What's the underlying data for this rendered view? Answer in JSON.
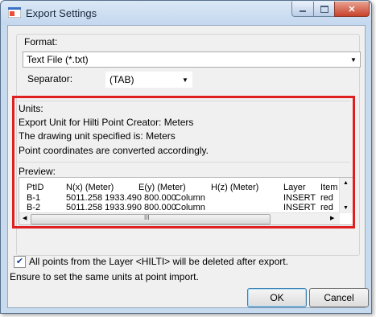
{
  "window": {
    "title": "Export Settings"
  },
  "format": {
    "label": "Format:",
    "selected": "Text File (*.txt)"
  },
  "separator": {
    "label": "Separator:",
    "selected": "(TAB)"
  },
  "units": {
    "header": "Units:",
    "line1": "Export Unit for Hilti Point Creator: Meters",
    "line2": "The drawing unit specified is: Meters",
    "line3": "Point coordinates are converted accordingly."
  },
  "preview": {
    "label": "Preview:",
    "columns": [
      "PtID",
      "N(x) (Meter)",
      "E(y) (Meter)",
      "H(z) (Meter)",
      "Layer",
      "Item No"
    ],
    "rows": [
      {
        "id": "B-1",
        "values": "5011.258 1933.490 800.000",
        "desc": "Column",
        "layer": "INSERT",
        "item": "red"
      },
      {
        "id": "B-2",
        "values": "5011.258 1933.990 800.000",
        "desc": "Column",
        "layer": "INSERT",
        "item": "red"
      }
    ],
    "scroll_thumb_glyph": "III"
  },
  "delete_check": {
    "checked": true,
    "label": "All points from the Layer <HILTI> will be deleted after export."
  },
  "note": "Ensure to set the same units at point import.",
  "buttons": {
    "ok": "OK",
    "cancel": "Cancel"
  },
  "colors": {
    "highlight_border": "#e02020",
    "title_bar": "#c7daee"
  }
}
